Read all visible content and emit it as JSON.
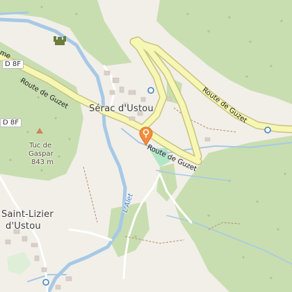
{
  "map": {
    "places": {
      "serac": "Sérac d'Ustou",
      "saint_lizier_1": "Saint-Lizier",
      "saint_lizier_2": "d'Ustou",
      "tuc_name_1": "Tuc de",
      "tuc_name_2": "Gaspar",
      "tuc_elev": "843 m"
    },
    "roads": {
      "route_guzet": "Route de Guzet",
      "shield_d8f_top": "D 8F",
      "shield_d8f_left": "D 8F",
      "shield_partial_me": "me"
    },
    "water": {
      "river": "L'Alet"
    },
    "colors": {
      "forest": "#c8deb0",
      "land": "#f2efe9",
      "road_fill": "#f6f7b4",
      "road_casing": "#c9c27a",
      "water": "#a6c9e6",
      "marker": "#f28c3b"
    },
    "marker_icon": "location-pin-icon"
  }
}
